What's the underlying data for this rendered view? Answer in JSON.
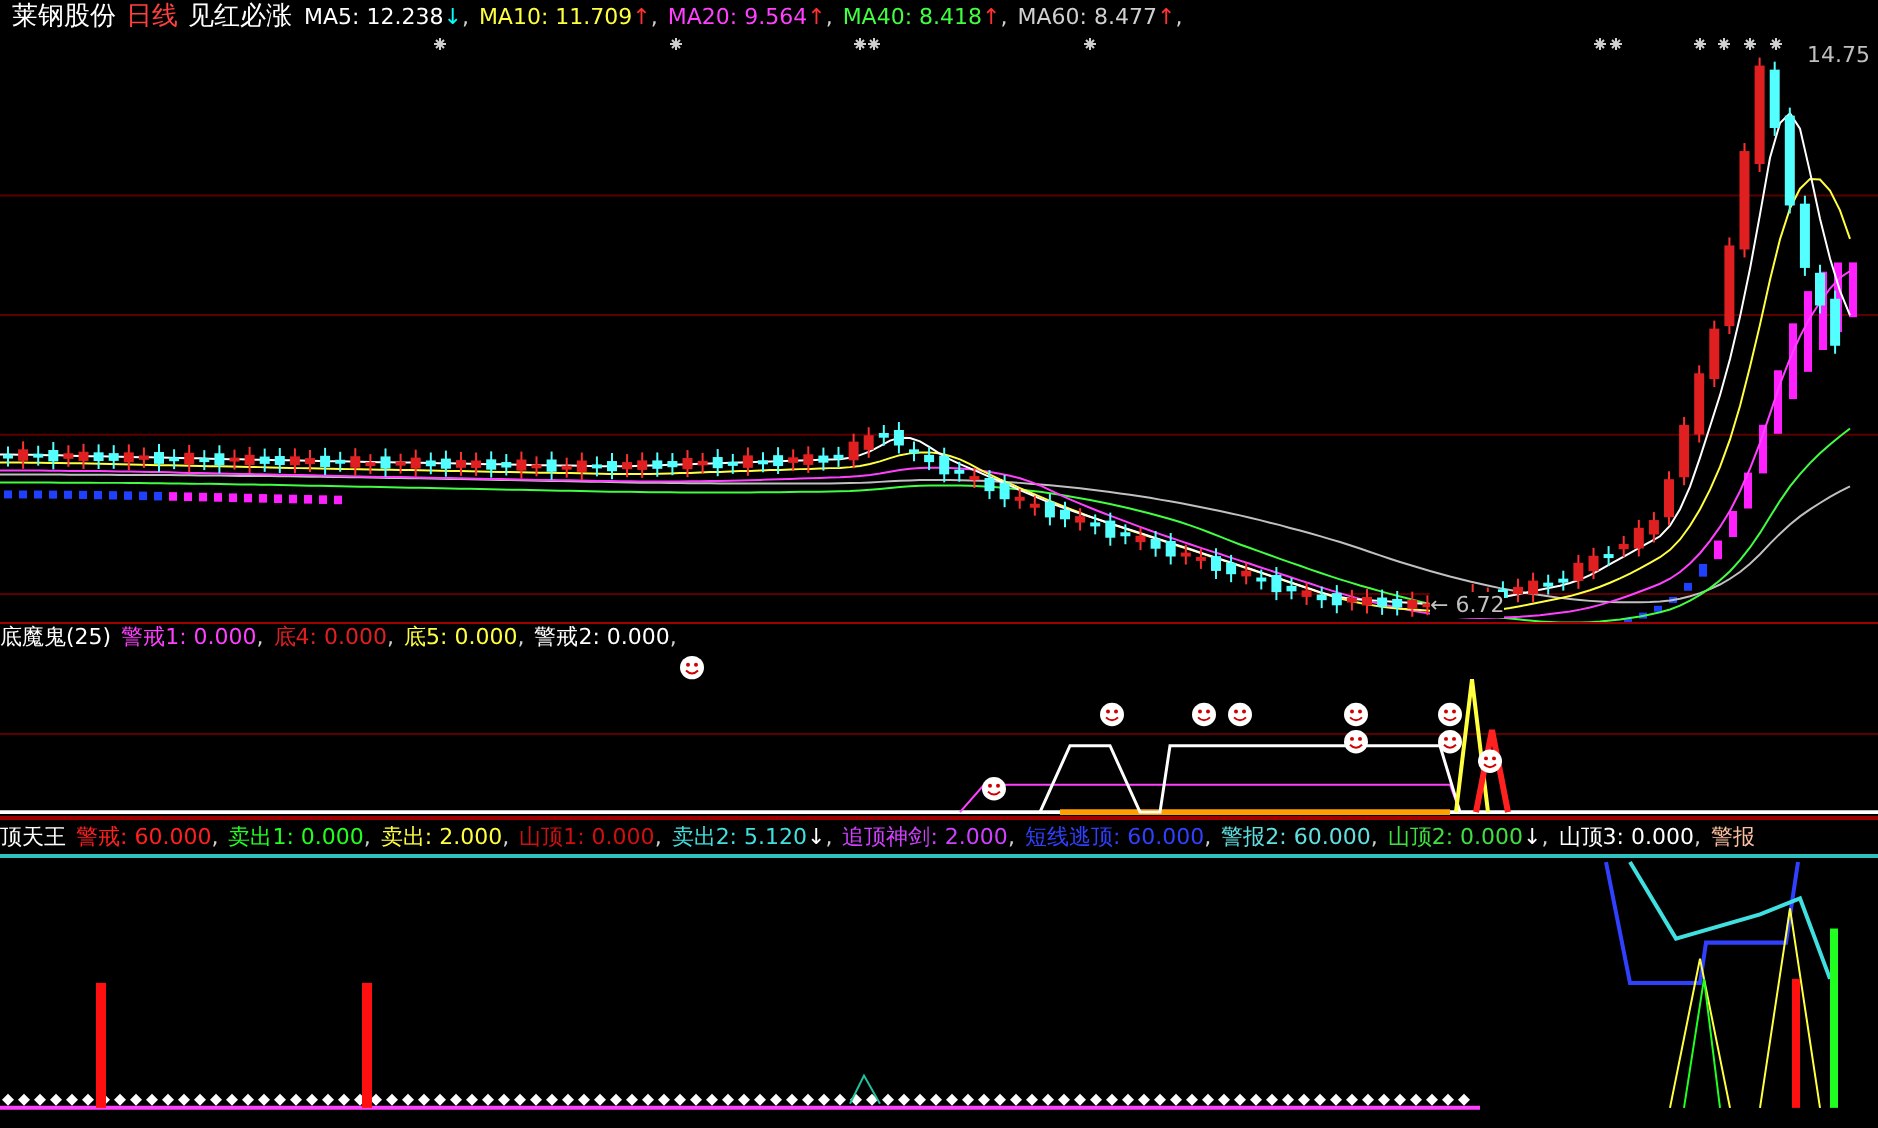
{
  "price_panel": {
    "stock": "莱钢股份",
    "period": "日线",
    "formula": "见红必涨",
    "legend": [
      {
        "text": "MA5: 12.238",
        "arrow": {
          "text": "↓",
          "color": "#00ffff"
        },
        "sep": ",",
        "color": "#ffffff"
      },
      {
        "text": "MA10: 11.709",
        "arrow": {
          "text": "↑",
          "color": "#ff3030"
        },
        "sep": ",",
        "color": "#ffff40"
      },
      {
        "text": "MA20: 9.564",
        "arrow": {
          "text": "↑",
          "color": "#ff3030"
        },
        "sep": ",",
        "color": "#ff40ff"
      },
      {
        "text": "MA40: 8.418",
        "arrow": {
          "text": "↑",
          "color": "#ff3030"
        },
        "sep": ",",
        "color": "#40ff40"
      },
      {
        "text": "MA60: 8.477",
        "arrow": {
          "text": "↑",
          "color": "#ff3030"
        },
        "sep": ",",
        "color": "#d0d0d0"
      }
    ],
    "high_label": "14.75",
    "low_label": "← 6.72"
  },
  "indicator_panel_1": {
    "title": "底魔鬼(25)",
    "legend": [
      {
        "text": "警戒1: 0.000",
        "sep": ",",
        "color": "#ff40ff"
      },
      {
        "text": "底4: 0.000",
        "sep": ",",
        "color": "#e02020"
      },
      {
        "text": "底5: 0.000",
        "sep": ",",
        "color": "#ffff40"
      },
      {
        "text": "警戒2: 0.000",
        "sep": ",",
        "color": "#ffffff"
      }
    ]
  },
  "indicator_panel_2": {
    "title": "顶天王",
    "legend": [
      {
        "text": "警戒: 60.000",
        "sep": ",",
        "color": "#ff2020"
      },
      {
        "text": "卖出1: 0.000",
        "sep": ",",
        "color": "#20ff20"
      },
      {
        "text": "卖出: 2.000",
        "sep": ",",
        "color": "#ffff40"
      },
      {
        "text": "山顶1: 0.000",
        "sep": ",",
        "color": "#d01010"
      },
      {
        "text": "卖出2: 5.120",
        "arrow": {
          "text": "↓",
          "color": "#ffffff"
        },
        "sep": ",",
        "color": "#40e0e0"
      },
      {
        "text": "追顶神剑: 2.000",
        "sep": ",",
        "color": "#d040ff"
      },
      {
        "text": "短线逃顶: 60.000",
        "sep": ",",
        "color": "#3040ff"
      },
      {
        "text": "警报2: 60.000",
        "sep": ",",
        "color": "#60e0e0"
      },
      {
        "text": "山顶2: 0.000",
        "arrow": {
          "text": "↓",
          "color": "#ffffff"
        },
        "sep": ",",
        "color": "#40e040"
      },
      {
        "text": "山顶3: 0.000",
        "sep": ",",
        "color": "#ffffff"
      },
      {
        "text": "警报",
        "color": "#ffc0a0"
      }
    ]
  }
}
